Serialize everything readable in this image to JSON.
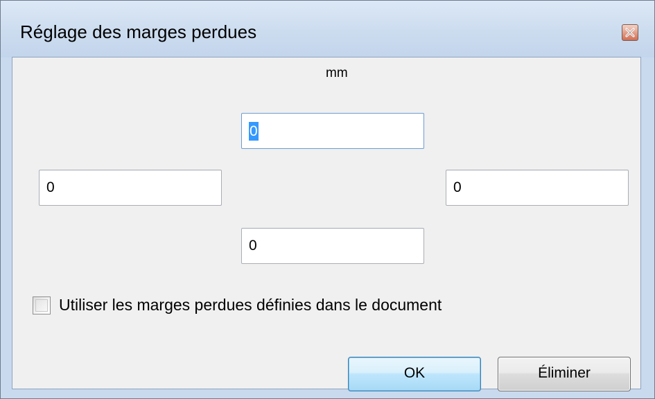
{
  "window": {
    "title": "Réglage des marges perdues",
    "close_icon": "close-icon"
  },
  "unit_label": "mm",
  "margins": {
    "top": "0",
    "left": "0",
    "right": "0",
    "bottom": "0"
  },
  "use_document_bleeds": {
    "label": "Utiliser les marges perdues définies dans le document",
    "checked": false
  },
  "buttons": {
    "ok": "OK",
    "cancel": "Éliminer"
  },
  "colors": {
    "frame": "#c9daee",
    "client": "#f0f0f0",
    "selection": "#3399ff",
    "close_button": "#d9806a"
  }
}
